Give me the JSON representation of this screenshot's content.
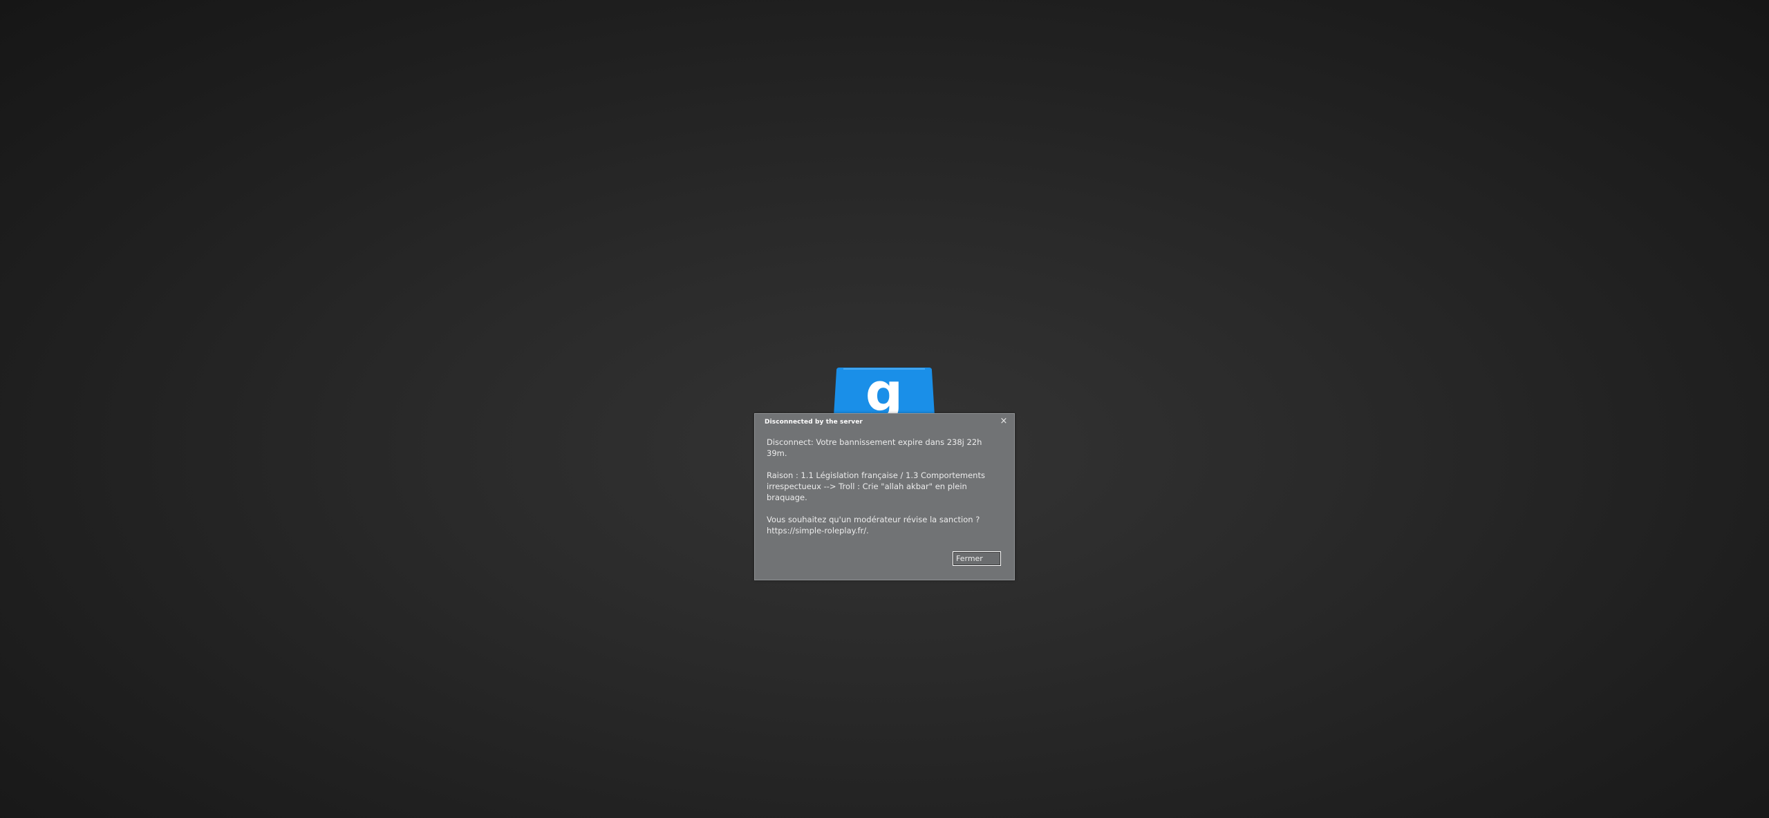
{
  "logo": {
    "icon": "garrysmod-logo-icon",
    "color": "#1a8fe8"
  },
  "dialog": {
    "title": "Disconnected by the server",
    "close_icon": "close-icon",
    "close_glyph": "×",
    "message_line1": "Disconnect: Votre bannissement expire dans 238j 22h 39m.",
    "message_line2": "Raison : 1.1 Législation française / 1.3 Comportements irrespectueux --> Troll : Crie \"allah akbar\" en plein braquage.",
    "message_line3": "Vous souhaitez qu'un modérateur révise la sanction ? https://simple-roleplay.fr/.",
    "close_button_label": "Fermer"
  }
}
